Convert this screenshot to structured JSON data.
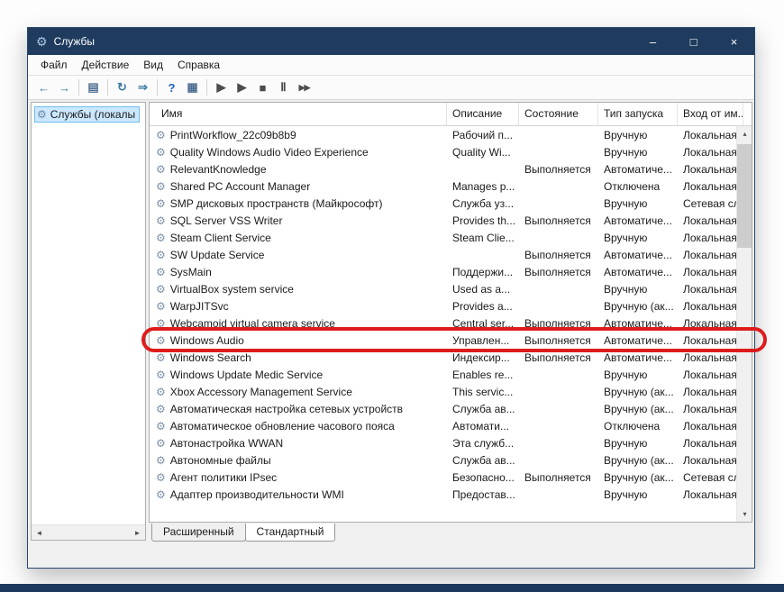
{
  "window": {
    "title": "Службы",
    "controls": {
      "minimize": "–",
      "maximize": "□",
      "close": "×"
    }
  },
  "menu": {
    "items": [
      "Файл",
      "Действие",
      "Вид",
      "Справка"
    ]
  },
  "toolbar": {
    "buttons": [
      {
        "name": "back-button",
        "glyph": "←",
        "color": "#3d7aa5"
      },
      {
        "name": "forward-button",
        "glyph": "→",
        "color": "#3d7aa5"
      },
      {
        "name": "separator"
      },
      {
        "name": "show-console-tree-button",
        "glyph": "▤",
        "color": "#4e6f93"
      },
      {
        "name": "separator"
      },
      {
        "name": "refresh-button",
        "glyph": "↻",
        "color": "#3d7aa5"
      },
      {
        "name": "export-list-button",
        "glyph": "⇒",
        "color": "#3d7aa5"
      },
      {
        "name": "separator"
      },
      {
        "name": "help-button",
        "glyph": "?",
        "color": "#2063b8"
      },
      {
        "name": "properties-button",
        "glyph": "▦",
        "color": "#4e6f93"
      },
      {
        "name": "separator"
      },
      {
        "name": "start-service-button",
        "glyph": "▶",
        "color": "#4c4c4c"
      },
      {
        "name": "resume-service-button",
        "glyph": "▶",
        "color": "#4c4c4c"
      },
      {
        "name": "stop-service-button",
        "glyph": "■",
        "color": "#4c4c4c"
      },
      {
        "name": "pause-service-button",
        "glyph": "Ⅱ",
        "color": "#4c4c4c"
      },
      {
        "name": "restart-service-button",
        "glyph": "▶▶",
        "color": "#4c4c4c",
        "small": true
      }
    ]
  },
  "sidebar": {
    "root_label": "Службы (локалы"
  },
  "table": {
    "columns": [
      "Имя",
      "Описание",
      "Состояние",
      "Тип запуска",
      "Вход от им..."
    ],
    "rows": [
      {
        "name": "PrintWorkflow_22c09b8b9",
        "desc": "Рабочий п...",
        "status": "",
        "type": "Вручную",
        "logon": "Локальная"
      },
      {
        "name": "Quality Windows Audio Video Experience",
        "desc": "Quality Wi...",
        "status": "",
        "type": "Вручную",
        "logon": "Локальная"
      },
      {
        "name": "RelevantKnowledge",
        "desc": "",
        "status": "Выполняется",
        "type": "Автоматиче...",
        "logon": "Локальная"
      },
      {
        "name": "Shared PC Account Manager",
        "desc": "Manages p...",
        "status": "",
        "type": "Отключена",
        "logon": "Локальная"
      },
      {
        "name": "SMP дисковых пространств (Майкрософт)",
        "desc": "Служба уз...",
        "status": "",
        "type": "Вручную",
        "logon": "Сетевая сл..."
      },
      {
        "name": "SQL Server VSS Writer",
        "desc": "Provides th...",
        "status": "Выполняется",
        "type": "Автоматиче...",
        "logon": "Локальная"
      },
      {
        "name": "Steam Client Service",
        "desc": "Steam Clie...",
        "status": "",
        "type": "Вручную",
        "logon": "Локальная"
      },
      {
        "name": "SW Update Service",
        "desc": "",
        "status": "Выполняется",
        "type": "Автоматиче...",
        "logon": "Локальная"
      },
      {
        "name": "SysMain",
        "desc": "Поддержи...",
        "status": "Выполняется",
        "type": "Автоматиче...",
        "logon": "Локальная"
      },
      {
        "name": "VirtualBox system service",
        "desc": "Used as a...",
        "status": "",
        "type": "Вручную",
        "logon": "Локальная"
      },
      {
        "name": "WarpJITSvc",
        "desc": "Provides a...",
        "status": "",
        "type": "Вручную (ак...",
        "logon": "Локальная"
      },
      {
        "name": "Webcamoid virtual camera service",
        "desc": "Central ser...",
        "status": "Выполняется",
        "type": "Автоматиче...",
        "logon": "Локальная"
      },
      {
        "name": "Windows Audio",
        "desc": "Управлен...",
        "status": "Выполняется",
        "type": "Автоматиче...",
        "logon": "Локальная"
      },
      {
        "name": "Windows Search",
        "desc": "Индексир...",
        "status": "Выполняется",
        "type": "Автоматиче...",
        "logon": "Локальная"
      },
      {
        "name": "Windows Update Medic Service",
        "desc": "Enables re...",
        "status": "",
        "type": "Вручную",
        "logon": "Локальная"
      },
      {
        "name": "Xbox Accessory Management Service",
        "desc": "This servic...",
        "status": "",
        "type": "Вручную (ак...",
        "logon": "Локальная"
      },
      {
        "name": "Автоматическая настройка сетевых устройств",
        "desc": "Служба ав...",
        "status": "",
        "type": "Вручную (ак...",
        "logon": "Локальная"
      },
      {
        "name": "Автоматическое обновление часового пояса",
        "desc": "Автомати...",
        "status": "",
        "type": "Отключена",
        "logon": "Локальная"
      },
      {
        "name": "Автонастройка WWAN",
        "desc": "Эта служб...",
        "status": "",
        "type": "Вручную",
        "logon": "Локальная"
      },
      {
        "name": "Автономные файлы",
        "desc": "Служба ав...",
        "status": "",
        "type": "Вручную (ак...",
        "logon": "Локальная"
      },
      {
        "name": "Агент политики IPsec",
        "desc": "Безопасно...",
        "status": "Выполняется",
        "type": "Вручную (ак...",
        "logon": "Сетевая сл..."
      },
      {
        "name": "Адаптер производительности WMI",
        "desc": "Предостав...",
        "status": "",
        "type": "Вручную",
        "logon": "Локальная"
      }
    ]
  },
  "tabs": {
    "items": [
      {
        "label": "Расширенный"
      },
      {
        "label": "Стандартный"
      }
    ]
  },
  "icons": {
    "app_glyph": "⚙",
    "service_glyph": "⚙",
    "sidebar_glyph": "⚙",
    "scroll_up": "▴",
    "scroll_down": "▾",
    "scroll_left": "◄",
    "scroll_right": "►"
  },
  "highlight": {
    "target": "Windows Audio",
    "color": "#de1c1c"
  }
}
